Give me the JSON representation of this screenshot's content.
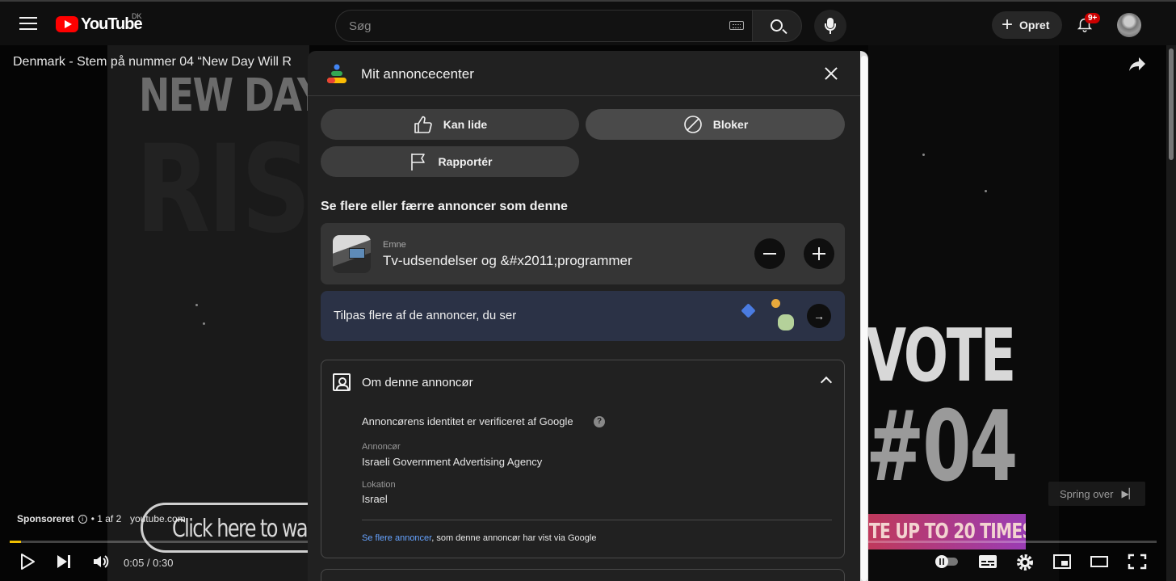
{
  "header": {
    "logo_text": "YouTube",
    "region": "DK",
    "search_placeholder": "Søg",
    "create_label": "Opret",
    "notification_count": "9+"
  },
  "video": {
    "title": "Denmark - Stem på nummer 04 “New Day Will R",
    "overlay_headline": "NEW DAY",
    "overlay_rise": "RIS",
    "overlay_vote": "VOTE",
    "overlay_number": "#04",
    "overlay_banner": "TE UP TO 20 TIMES",
    "cta_text": "Click here to wa",
    "sponsored_label": "Sponsoreret",
    "ad_position": "• 1 af 2",
    "ad_domain": "youtube.com",
    "skip_label": "Spring over",
    "time_display": "0:05 / 0:30",
    "progress_fraction": 0.0,
    "accent_color": "#f0c000"
  },
  "panel": {
    "title": "Mit annoncecenter",
    "like_label": "Kan lide",
    "block_label": "Bloker",
    "report_label": "Rapportér",
    "section_heading": "Se flere eller færre annoncer som denne",
    "topic": {
      "label": "Emne",
      "value": "Tv-udsendelser og &#x2011;programmer"
    },
    "customize_text": "Tilpas flere af de annoncer, du ser",
    "advertiser": {
      "title": "Om denne annoncør",
      "verified_text": "Annoncørens identitet er verificeret af Google",
      "advertiser_label": "Annoncør",
      "advertiser_value": "Israeli Government Advertising Agency",
      "location_label": "Lokation",
      "location_value": "Israel",
      "see_more_link": "Se flere annoncer",
      "see_more_rest": ", som denne annoncør har vist via Google"
    }
  }
}
